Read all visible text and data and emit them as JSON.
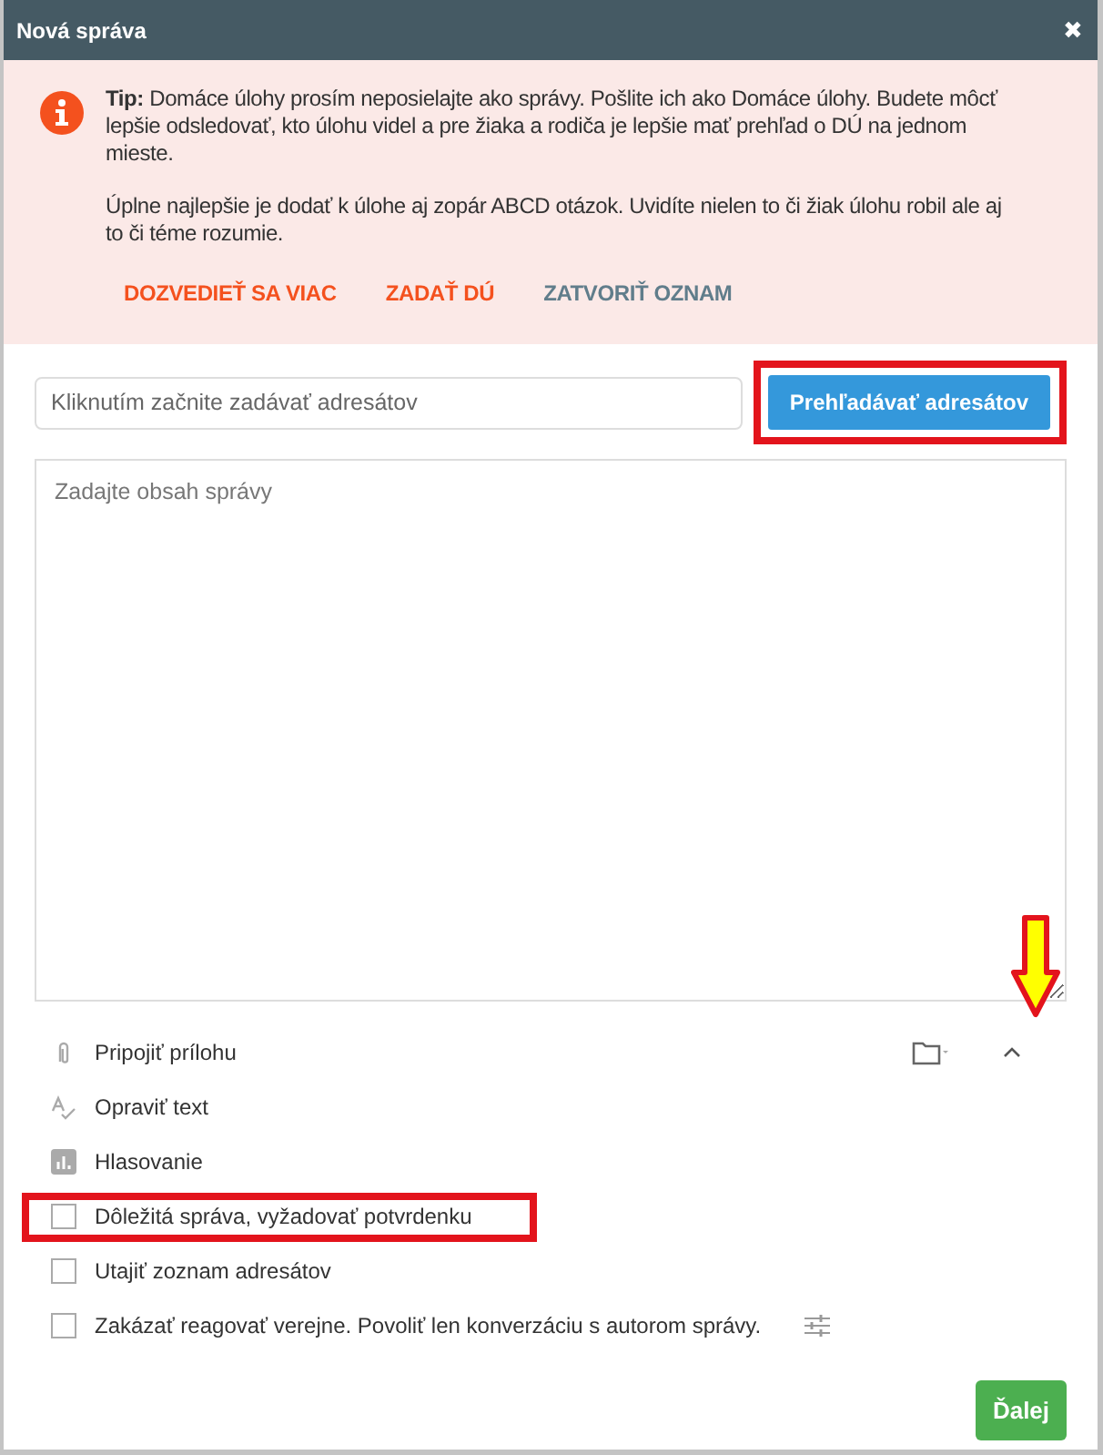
{
  "window": {
    "title": "Nová správa",
    "close": "✖"
  },
  "tip": {
    "paragraphs": [
      "**Tip:** Domáce úlohy prosím neposielajte ako správy. Pošlite ich ako Domáce úlohy. Budete môcť lepšie odsledovať, kto úlohu videl a pre žiaka a rodiča je lepšie mať prehľad o DÚ na jednom mieste.",
      "Úplne najlepšie je dodať k úlohe aj zopár ABCD otázok. Uvidíte nielen to či žiak úlohu robil ale aj to či téme rozumie."
    ],
    "actions": [
      {
        "label": "DOZVEDIEŤ SA VIAC",
        "kind": "accent"
      },
      {
        "label": "ZADAŤ DÚ",
        "kind": "accent"
      },
      {
        "label": "ZATVORIŤ OZNAM",
        "kind": "muted"
      }
    ]
  },
  "recipients": {
    "placeholder": "Kliknutím začnite zadávať adresátov",
    "button": "Prehľadávať adresátov"
  },
  "message": {
    "placeholder": "Zadajte obsah správy"
  },
  "options": [
    {
      "kind": "attach",
      "label": "Pripojiť prílohu"
    },
    {
      "kind": "spell",
      "label": "Opraviť text"
    },
    {
      "kind": "poll",
      "label": "Hlasovanie"
    },
    {
      "kind": "checkbox",
      "label": "Dôležitá správa, vyžadovať potvrdenku",
      "checked": false,
      "settings": false
    },
    {
      "kind": "checkbox",
      "label": "Utajiť zoznam adresátov",
      "checked": false,
      "settings": false
    },
    {
      "kind": "checkbox",
      "label": "Zakázať reagovať verejne. Povoliť len konverzáciu s autorom správy.",
      "checked": false,
      "settings": true
    }
  ],
  "next_button": "Ďalej"
}
